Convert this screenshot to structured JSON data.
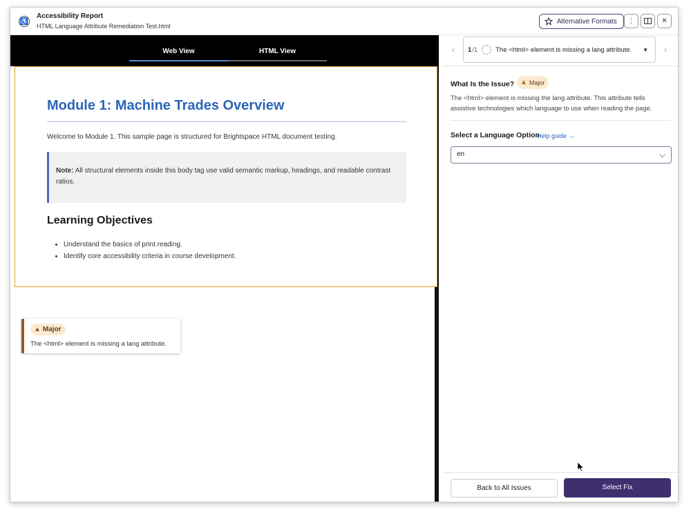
{
  "header": {
    "title": "Accessibility Report",
    "subtitle": "HTML Language Attribute Remediation Test.html",
    "alt_formats_label": "Alternative Formats",
    "more_icon": "kebab-icon",
    "layout_icon": "panel-layout-icon",
    "close_icon": "close-icon"
  },
  "left": {
    "tabs": [
      {
        "label": "Web View",
        "active": true
      },
      {
        "label": "HTML View",
        "active": false
      }
    ],
    "doc": {
      "heading": "Module 1: Machine Trades Overview",
      "welcome": "Welcome to Module 1. This sample page is structured for Brightspace HTML document testing.",
      "note_label": "Note:",
      "note_text": " All structural elements inside this body tag use valid semantic markup, headings, and readable contrast ratios.",
      "subheading": "Learning Objectives",
      "bullets": [
        "Understand the basics of print reading.",
        "Identify core accessibility criteria in course development."
      ]
    },
    "issue_card": {
      "severity": "Major",
      "text": "The <html> element is missing a lang attribute."
    }
  },
  "right": {
    "issue_counter": "1",
    "issue_total": "/1",
    "issue_title": "The <html> element is missing a lang attribute.",
    "question": "What Is the Issue?",
    "severity": "Major",
    "description": "The <html> element is missing the lang attribute. This attribute tells assistive technologies which language to use when reading the page.",
    "language_label": "Select a Language Option",
    "help_link": "Help guide →",
    "language_value": "en",
    "back_button": "Back to All Issues",
    "fix_button": "Select Fix"
  },
  "colors": {
    "accent": "#3f2f6e",
    "heading_blue": "#2a65b8",
    "major_bg": "#fbead2",
    "major_border": "#a0541a"
  }
}
